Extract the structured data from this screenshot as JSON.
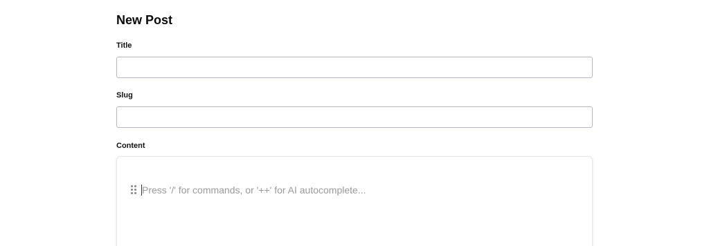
{
  "page": {
    "title": "New Post"
  },
  "form": {
    "title_field": {
      "label": "Title",
      "value": "",
      "placeholder": ""
    },
    "slug_field": {
      "label": "Slug",
      "value": "",
      "placeholder": ""
    },
    "content_field": {
      "label": "Content",
      "placeholder": "Press '/' for commands, or '++' for AI autocomplete...",
      "drag_handle_icon": "drag-handle-icon"
    }
  },
  "colors": {
    "input_border": "#b9b6c4",
    "editor_border": "#e6e6e6",
    "placeholder_text": "#9a9a9a"
  }
}
